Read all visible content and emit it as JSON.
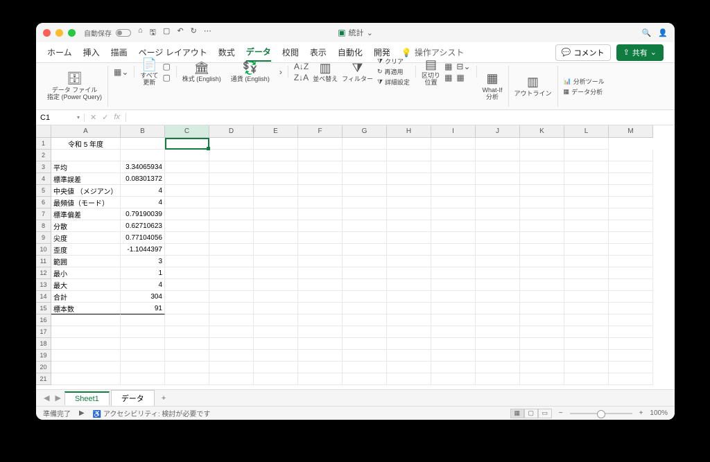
{
  "titlebar": {
    "autosave": "自動保存",
    "doc_title": "統計",
    "chev": "⌄"
  },
  "tabs": {
    "home": "ホーム",
    "insert": "挿入",
    "draw": "描画",
    "page_layout": "ページ レイアウト",
    "formulas": "数式",
    "data": "データ",
    "review": "校閲",
    "view": "表示",
    "automate": "自動化",
    "developer": "開発",
    "tell_me": "操作アシスト",
    "comment": "コメント",
    "share": "共有"
  },
  "ribbon": {
    "power_query": "データ ファイル\n指定 (Power Query)",
    "refresh_all": "すべて\n更新",
    "stocks": "株式 (English)",
    "currency": "通貨 (English)",
    "sort": "並べ替え",
    "filter": "フィルター",
    "clear": "クリア",
    "reapply": "再適用",
    "advanced": "詳細設定",
    "text_to_cols": "区切り\n位置",
    "whatif": "What-If\n分析",
    "outline": "アウトライン",
    "analysis_tools": "分析ツール",
    "data_analysis": "データ分析"
  },
  "namebox": "C1",
  "columns": [
    "A",
    "B",
    "C",
    "D",
    "E",
    "F",
    "G",
    "H",
    "I",
    "J",
    "K",
    "L",
    "M"
  ],
  "row_count": 21,
  "merged_header": "令和 5 年度",
  "stats": [
    {
      "label": "平均",
      "value": "3.34065934"
    },
    {
      "label": "標準誤差",
      "value": "0.08301372"
    },
    {
      "label": "中央値 （メジアン）",
      "value": "4"
    },
    {
      "label": "最頻値（モード）",
      "value": "4"
    },
    {
      "label": "標準偏差",
      "value": "0.79190039"
    },
    {
      "label": "分散",
      "value": "0.62710623"
    },
    {
      "label": "尖度",
      "value": "0.77104056"
    },
    {
      "label": "歪度",
      "value": "-1.1044397"
    },
    {
      "label": "範囲",
      "value": "3"
    },
    {
      "label": "最小",
      "value": "1"
    },
    {
      "label": "最大",
      "value": "4"
    },
    {
      "label": "合計",
      "value": "304"
    },
    {
      "label": "標本数",
      "value": "91"
    }
  ],
  "sheets": {
    "sheet1": "Sheet1",
    "sheet2": "データ"
  },
  "status": {
    "ready": "準備完了",
    "accessibility": "アクセシビリティ: 検討が必要です",
    "zoom": "100%"
  }
}
